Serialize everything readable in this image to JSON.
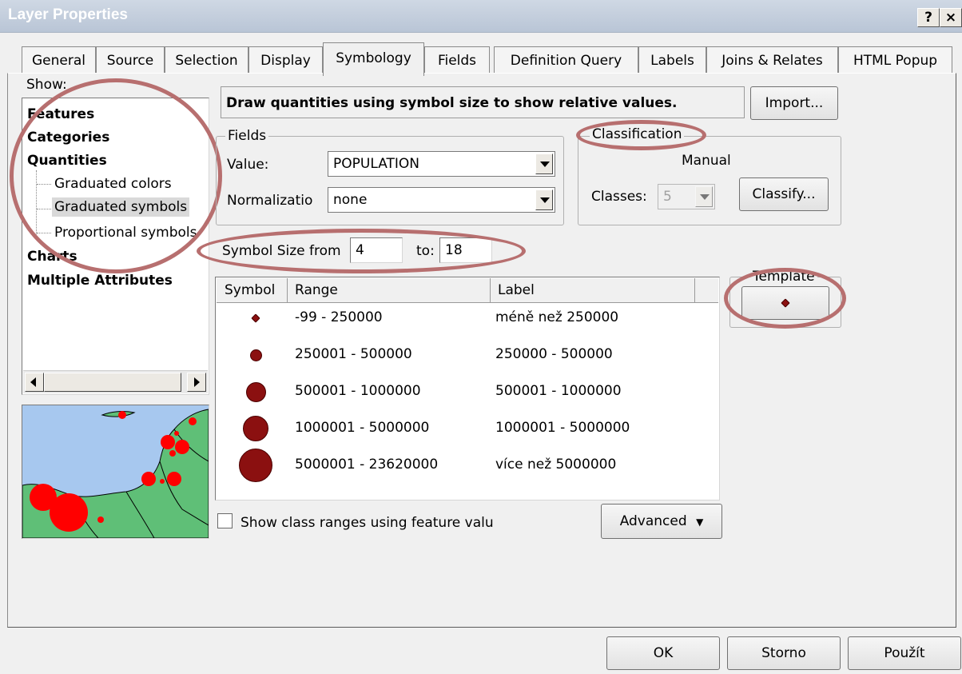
{
  "window": {
    "title": "Layer Properties",
    "help_label": "?",
    "close_label": "×"
  },
  "tabs": [
    {
      "label": "General"
    },
    {
      "label": "Source"
    },
    {
      "label": "Selection"
    },
    {
      "label": "Display"
    },
    {
      "label": "Symbology"
    },
    {
      "label": "Fields"
    },
    {
      "label": "Definition Query"
    },
    {
      "label": "Labels"
    },
    {
      "label": "Joins & Relates"
    },
    {
      "label": "HTML Popup"
    }
  ],
  "active_tab": "Symbology",
  "show": {
    "label": "Show:",
    "items": [
      {
        "label": "Features"
      },
      {
        "label": "Categories"
      },
      {
        "label": "Quantities"
      },
      {
        "label": "Graduated colors"
      },
      {
        "label": "Graduated symbols"
      },
      {
        "label": "Proportional symbols"
      },
      {
        "label": "Charts"
      },
      {
        "label": "Multiple Attributes"
      }
    ],
    "selected": "Graduated symbols"
  },
  "description": "Draw quantities using symbol size to show relative values.",
  "import_label": "Import...",
  "fields": {
    "title": "Fields",
    "value_label": "Value:",
    "value": "POPULATION",
    "normalization_label": "Normalizatio",
    "normalization": "none"
  },
  "classification": {
    "title": "Classification",
    "method": "Manual",
    "classes_label": "Classes:",
    "classes": "5",
    "classify_label": "Classify..."
  },
  "symbol_size": {
    "from_label": "Symbol Size from",
    "from": "4",
    "to_label": "to:",
    "to": "18"
  },
  "table": {
    "headers": [
      "Symbol",
      "Range",
      "Label"
    ],
    "rows": [
      {
        "range": "-99 - 250000",
        "label": "méně než 250000",
        "size": 4
      },
      {
        "range": "250001 - 500000",
        "label": "250000 - 500000",
        "size": 7
      },
      {
        "range": "500001 - 1000000",
        "label": "500001 - 1000000",
        "size": 11
      },
      {
        "range": "1000001 - 5000000",
        "label": "1000001 - 5000000",
        "size": 14
      },
      {
        "range": "5000001 - 23620000",
        "label": "více než 5000000",
        "size": 18
      }
    ]
  },
  "template": {
    "title": "Template"
  },
  "show_class_ranges": {
    "label": "Show class ranges using feature valu",
    "checked": false
  },
  "advanced_label": "Advanced",
  "footer": {
    "ok": "OK",
    "cancel": "Storno",
    "apply": "Použít"
  },
  "colors": {
    "symbol_fill": "#8b1010",
    "preview_land": "#5fbf77",
    "preview_water": "#a7c8ef",
    "preview_symbol": "#ff0000",
    "annotation": "#b76f6f"
  }
}
